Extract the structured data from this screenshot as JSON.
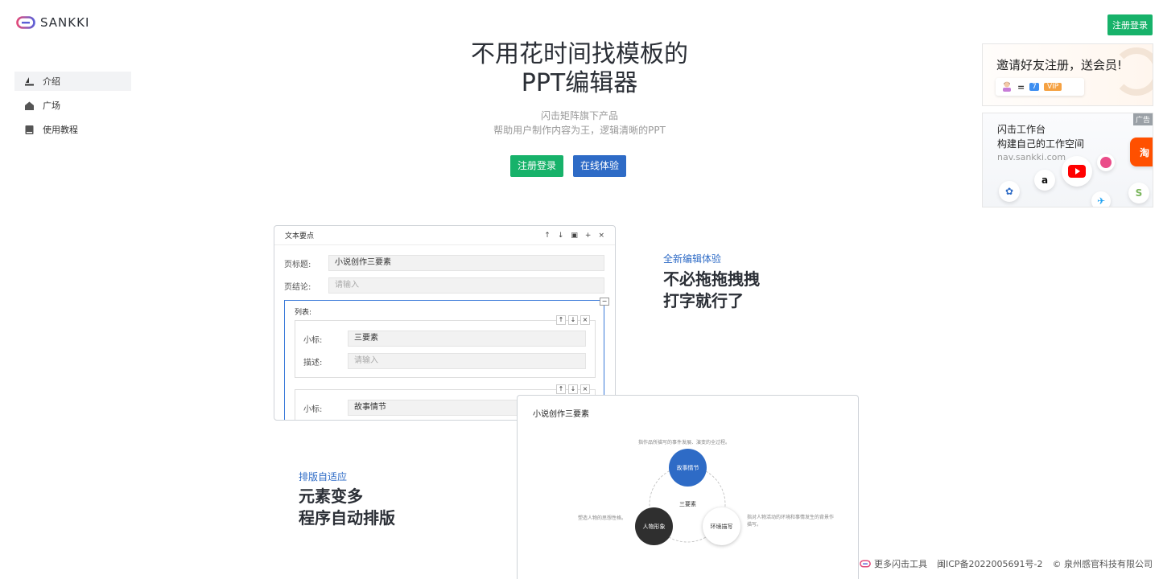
{
  "brand": {
    "name": "SANKKI",
    "accent": "#17b26a",
    "blue": "#2e6bc6"
  },
  "header": {
    "login_button": "注册登录"
  },
  "sidebar": {
    "items": [
      {
        "label": "介绍",
        "icon": "boat-icon",
        "active": true
      },
      {
        "label": "广场",
        "icon": "home-icon",
        "active": false
      },
      {
        "label": "使用教程",
        "icon": "book-icon",
        "active": false
      }
    ]
  },
  "hero": {
    "title_line1": "不用花时间找模板的",
    "title_line2": "PPT编辑器",
    "subtitle_line1": "闪击矩阵旗下产品",
    "subtitle_line2": "帮助用户制作内容为王，逻辑清晰的PPT",
    "primary_button": "注册登录",
    "secondary_button": "在线体验"
  },
  "ads": {
    "invite": {
      "title": "邀请好友注册，送会员!",
      "days": "7",
      "vip": "VIP"
    },
    "workspace": {
      "line1": "闪击工作台",
      "line2": "构建自己的工作空间",
      "url": "nav.sankki.com",
      "tag": "广告"
    }
  },
  "editor": {
    "title": "文本要点",
    "page_title_label": "页标题:",
    "page_title_value": "小说创作三要素",
    "page_conclusion_label": "页结论:",
    "page_conclusion_placeholder": "请输入",
    "list_label": "列表:",
    "items": [
      {
        "subtitle_label": "小标:",
        "subtitle_value": "三要素",
        "desc_label": "描述:",
        "desc_placeholder": "请输入"
      },
      {
        "subtitle_label": "小标:",
        "subtitle_value": "故事情节"
      }
    ]
  },
  "features": [
    {
      "tag": "全新编辑体验",
      "line1": "不必拖拖拽拽",
      "line2": "打字就行了"
    },
    {
      "tag": "排版自适应",
      "line1": "元素变多",
      "line2": "程序自动排版"
    }
  ],
  "slide": {
    "title": "小说创作三要素",
    "center": "三要素",
    "nodes": [
      {
        "label": "故事情节",
        "note": "指作品所描写的事件发展、演变的全过程。"
      },
      {
        "label": "人物形象",
        "note": "塑造人物的思想性格。"
      },
      {
        "label": "环境描写",
        "note": "指对人物活动的环境和事情发生的背景作描写。"
      }
    ]
  },
  "footer": {
    "more_tools": "更多闪击工具",
    "icp": "闽ICP备2022005691号-2",
    "copyright": "© 泉州感官科技有限公司"
  }
}
